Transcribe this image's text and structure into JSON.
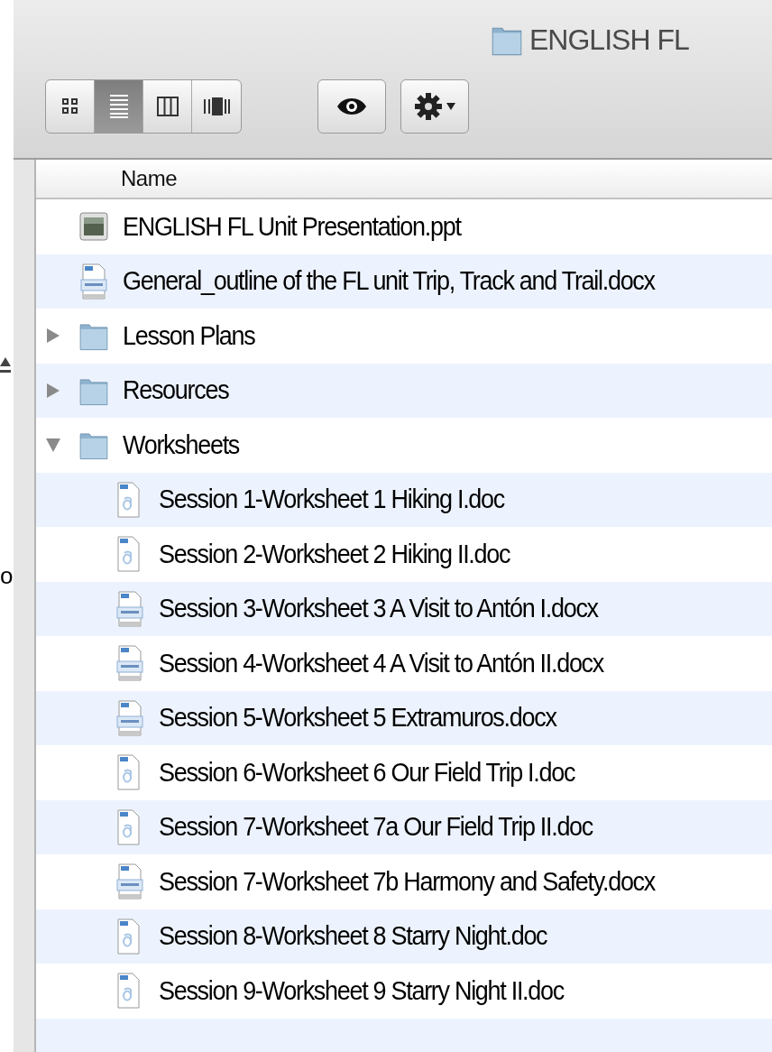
{
  "window": {
    "title": "ENGLISH FL"
  },
  "toolbar": {
    "view_buttons": [
      {
        "kind": "icon",
        "selected": false
      },
      {
        "kind": "list",
        "selected": true
      },
      {
        "kind": "columns",
        "selected": false
      },
      {
        "kind": "coverflow",
        "selected": false
      }
    ]
  },
  "sidebar": {
    "cut_text": "o"
  },
  "list": {
    "column": "Name",
    "items": [
      {
        "kind": "ppt",
        "name": "ENGLISH FL Unit Presentation.ppt"
      },
      {
        "kind": "docx",
        "name": "General_outline of the FL unit Trip, Track and Trail.docx"
      },
      {
        "kind": "folder",
        "name": "Lesson Plans",
        "expanded": false
      },
      {
        "kind": "folder",
        "name": "Resources",
        "expanded": false
      },
      {
        "kind": "folder",
        "name": "Worksheets",
        "expanded": true,
        "children": [
          {
            "kind": "doc",
            "name": "Session 1-Worksheet 1 Hiking I.doc"
          },
          {
            "kind": "doc",
            "name": "Session 2-Worksheet 2 Hiking II.doc"
          },
          {
            "kind": "docx",
            "name": "Session 3-Worksheet 3  A Visit to Antón I.docx"
          },
          {
            "kind": "docx",
            "name": "Session 4-Worksheet 4  A Visit to Antón II.docx"
          },
          {
            "kind": "docx",
            "name": "Session 5-Worksheet 5 Extramuros.docx"
          },
          {
            "kind": "doc",
            "name": "Session 6-Worksheet 6 Our Field Trip I.doc"
          },
          {
            "kind": "doc",
            "name": "Session 7-Worksheet 7a Our Field Trip II.doc"
          },
          {
            "kind": "docx",
            "name": "Session 7-Worksheet 7b Harmony and Safety.docx"
          },
          {
            "kind": "doc",
            "name": "Session 8-Worksheet 8 Starry Night.doc"
          },
          {
            "kind": "doc",
            "name": "Session 9-Worksheet 9 Starry Night II.doc"
          }
        ]
      }
    ]
  }
}
